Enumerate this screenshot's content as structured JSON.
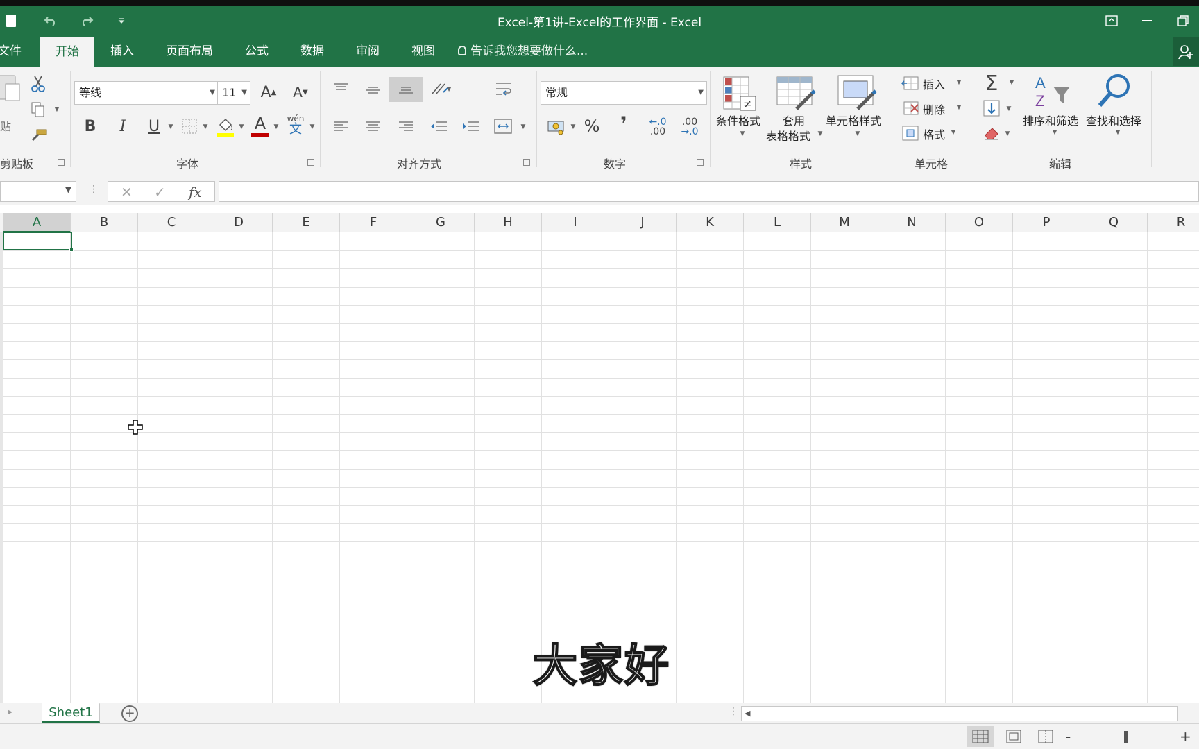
{
  "window": {
    "title": "Excel-第1讲-Excel的工作界面 - Excel"
  },
  "quick_access": {
    "save_icon": "save-icon",
    "undo_icon": "undo-icon",
    "redo_icon": "redo-icon",
    "customize_icon": "customize-qat-icon"
  },
  "tabs": [
    {
      "label": "文件"
    },
    {
      "label": "开始"
    },
    {
      "label": "插入"
    },
    {
      "label": "页面布局"
    },
    {
      "label": "公式"
    },
    {
      "label": "数据"
    },
    {
      "label": "审阅"
    },
    {
      "label": "视图"
    }
  ],
  "active_tab": "开始",
  "tellme": {
    "placeholder": "告诉我您想要做什么..."
  },
  "ribbon": {
    "clipboard": {
      "paste_label": "贴",
      "group_label": "剪贴板"
    },
    "font": {
      "font_name": "等线",
      "font_size": "11",
      "bold": "B",
      "italic": "I",
      "underline": "U",
      "phonetic_top": "wén",
      "phonetic_bottom": "文",
      "grow_font": "A",
      "shrink_font": "A",
      "font_color_letter": "A",
      "group_label": "字体"
    },
    "alignment": {
      "group_label": "对齐方式"
    },
    "number": {
      "format": "常规",
      "percent": "%",
      "comma": "❜",
      "inc_decimal_top": "←.0",
      "inc_decimal_bottom": ".00",
      "dec_decimal_top": ".00",
      "dec_decimal_bottom": "→.0",
      "group_label": "数字"
    },
    "styles": {
      "conditional": "条件格式",
      "table_line1": "套用",
      "table_line2": "表格格式",
      "cell_styles": "单元格样式",
      "group_label": "样式"
    },
    "cells": {
      "insert": "插入",
      "delete": "删除",
      "format": "格式",
      "group_label": "单元格"
    },
    "editing": {
      "sum": "Σ",
      "sort_filter": "排序和筛选",
      "find_select": "查找和选择",
      "group_label": "编辑"
    }
  },
  "formula_bar": {
    "name_box": "",
    "cancel": "✕",
    "enter": "✓",
    "fx": "fx",
    "formula": ""
  },
  "grid": {
    "columns": [
      "A",
      "B",
      "C",
      "D",
      "E",
      "F",
      "G",
      "H",
      "I",
      "J",
      "K",
      "L",
      "M",
      "N",
      "O",
      "P",
      "Q",
      "R"
    ],
    "selected_column": "A",
    "active_cell": "A1"
  },
  "caption": "大家好",
  "sheet_tabs": [
    {
      "label": "Sheet1"
    }
  ],
  "add_sheet": "⊕",
  "status": {
    "zoom_minus": "-",
    "zoom_plus": "+"
  },
  "colors": {
    "accent": "#217346",
    "ribbon_bg": "#f3f3f3",
    "font_color_bar": "#c00000",
    "highlight_bar": "#ffff00"
  }
}
